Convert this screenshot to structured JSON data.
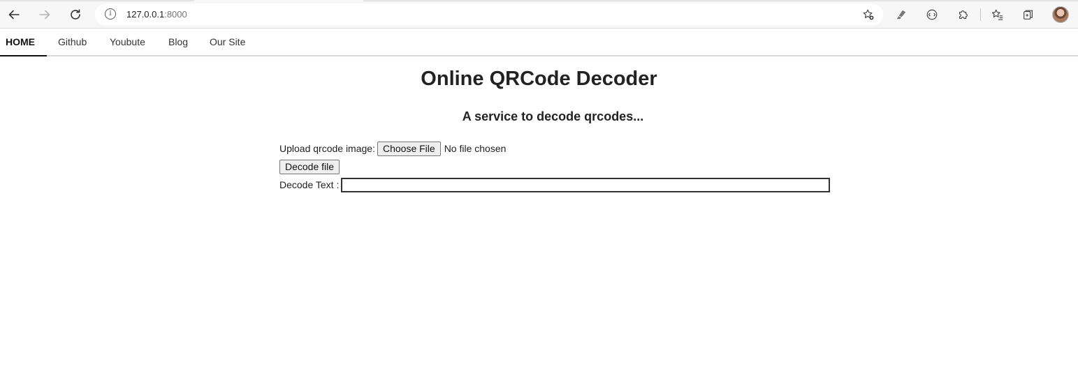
{
  "browser": {
    "url_host": "127.0.0.1",
    "url_port": ":8000"
  },
  "nav": {
    "items": [
      {
        "label": "HOME"
      },
      {
        "label": "Github"
      },
      {
        "label": "Youbute"
      },
      {
        "label": "Blog"
      },
      {
        "label": "Our Site"
      }
    ]
  },
  "main": {
    "title": "Online QRCode Decoder",
    "subtitle": "A service to decode qrcodes...",
    "upload_label": "Upload qrcode image:",
    "choose_file_label": "Choose File",
    "file_status": "No file chosen",
    "decode_button_label": "Decode file",
    "decode_text_label": "Decode Text :",
    "decode_text_value": ""
  }
}
